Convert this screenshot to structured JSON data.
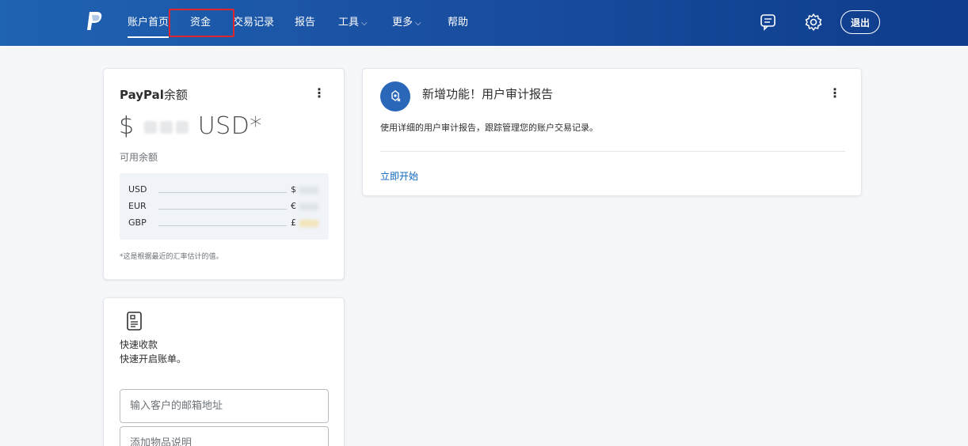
{
  "nav": {
    "items": [
      {
        "label": "账户首页",
        "caret": false
      },
      {
        "label": "资金",
        "caret": false
      },
      {
        "label": "交易记录",
        "caret": false
      },
      {
        "label": "报告",
        "caret": false
      },
      {
        "label": "工具",
        "caret": true
      },
      {
        "label": "更多",
        "caret": true
      },
      {
        "label": "帮助",
        "caret": false
      }
    ],
    "caret_glyph": "⌵",
    "logout_label": "退出",
    "icons": [
      "paypal-logo",
      "message-icon",
      "gear-icon"
    ]
  },
  "balance": {
    "title_brand": "PayPal",
    "title_suffix": "余额",
    "amount_prefix": "$",
    "amount_suffix": "USD*",
    "available_label": "可用余额",
    "currencies": [
      {
        "code": "USD",
        "symbol": "$"
      },
      {
        "code": "EUR",
        "symbol": "€"
      },
      {
        "code": "GBP",
        "symbol": "£"
      }
    ],
    "footnote": "*这是根据最近的汇率估计的值。"
  },
  "feature": {
    "title": "新增功能！用户审计报告",
    "description": "使用详细的用户审计报告，跟踪管理您的账户交易记录。",
    "link": "立即开始"
  },
  "invoice": {
    "title": "快速收款",
    "subtitle": "快速开启账单。",
    "email_placeholder": "输入客户的邮箱地址",
    "item_placeholder": "添加物品说明"
  },
  "colors": {
    "nav_gradient_start": "#1f63b3",
    "nav_gradient_end": "#0f3c8c",
    "highlight": "#e0252d",
    "link": "#0d66c2",
    "icon_circle": "#2a67b8"
  }
}
